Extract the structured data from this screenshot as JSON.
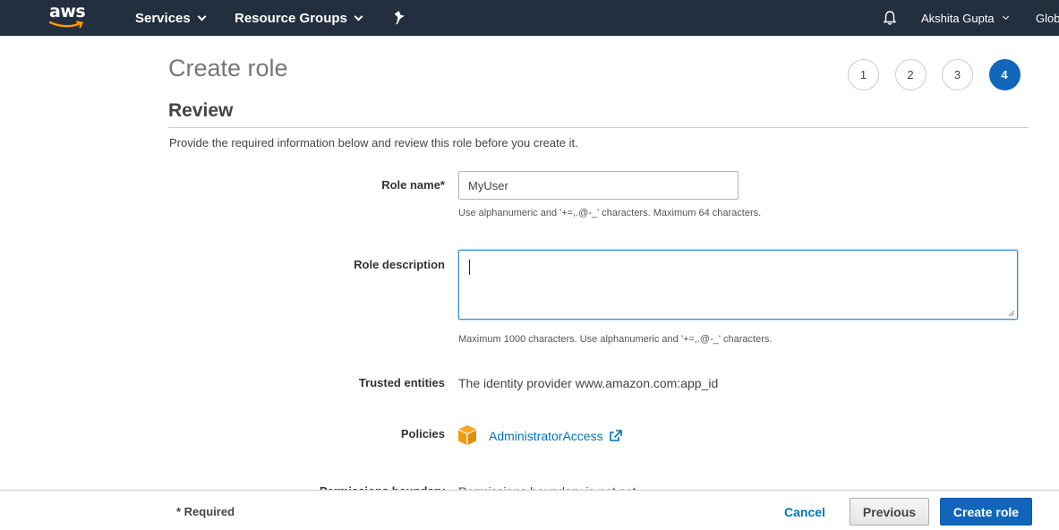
{
  "topnav": {
    "logo_text": "aws",
    "services_label": "Services",
    "resource_groups_label": "Resource Groups",
    "user_name": "Akshita Gupta",
    "region_label": "Glob"
  },
  "page": {
    "title": "Create role",
    "steps": [
      "1",
      "2",
      "3",
      "4"
    ],
    "active_step": 4,
    "section_title": "Review",
    "intro": "Provide the required information below and review this role before you create it."
  },
  "form": {
    "role_name": {
      "label": "Role name*",
      "value": "MyUser",
      "hint": "Use alphanumeric and '+=,.@-_' characters. Maximum 64 characters."
    },
    "role_description": {
      "label": "Role description",
      "value": "",
      "hint": "Maximum 1000 characters. Use alphanumeric and '+=,.@-_' characters."
    },
    "trusted_entities": {
      "label": "Trusted entities",
      "value": "The identity provider www.amazon.com:app_id"
    },
    "policies": {
      "label": "Policies",
      "link": "AdministratorAccess"
    },
    "permissions_boundary": {
      "label": "Permissions boundary",
      "value": "Permissions boundary is not set"
    }
  },
  "footer": {
    "required_note": "* Required",
    "cancel_label": "Cancel",
    "previous_label": "Previous",
    "create_label": "Create role"
  },
  "colors": {
    "nav_bg": "#232f3e",
    "primary": "#1166bb",
    "link": "#0073bb",
    "logo_accent": "#ff9900"
  }
}
